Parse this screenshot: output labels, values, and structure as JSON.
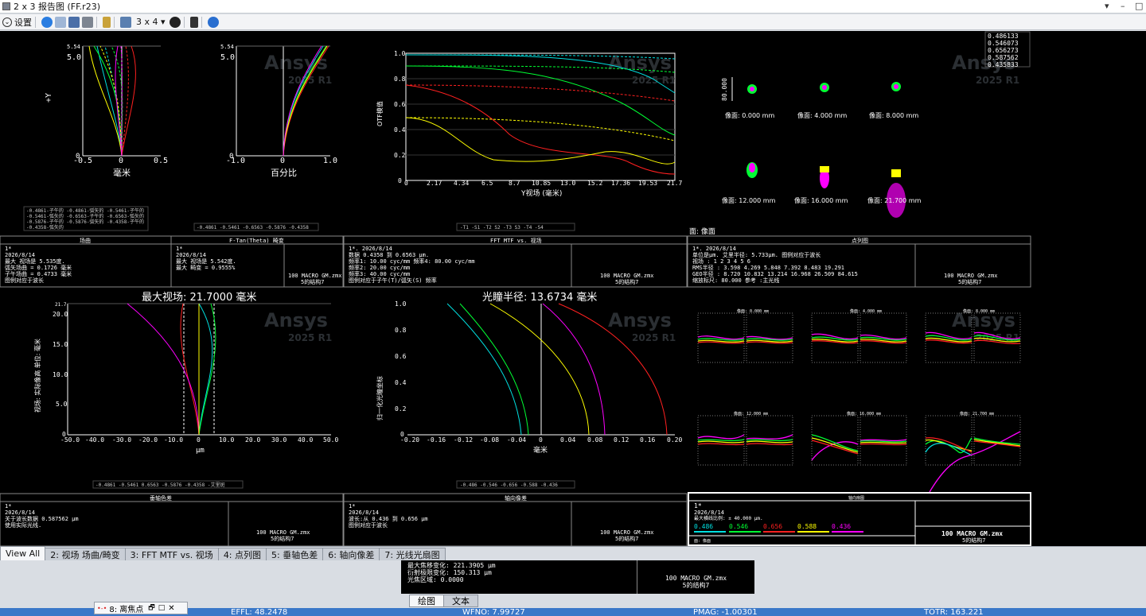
{
  "window": {
    "title": "2 x 3 报告图 (FF.r23)",
    "controls": [
      "▾",
      "–",
      "□"
    ]
  },
  "toolbar": {
    "settings_label": "设置",
    "layout_label": "3 x 4 ▾"
  },
  "watermark": {
    "line1": "Ansys",
    "line2": "2025 R1"
  },
  "panels": {
    "field_curv": {
      "axis_y_top": "5.54",
      "axis_y_mid": "5.0",
      "axis_y_zero": "0",
      "ylabel": "+Y",
      "xticks": [
        "-0.5",
        "0",
        "0.5"
      ],
      "xlabel": "毫米",
      "legend": [
        "-0.4861-子午的",
        "-0.4861-弧矢的",
        "-0.5461-子午的",
        "-0.5461-弧矢的",
        "-0.6563-子午的",
        "-0.6563-弧矢的",
        "-0.5876-子午的",
        "-0.5876-弧矢的",
        "-0.4358-子午的",
        "-0.4358-弧矢的"
      ]
    },
    "distortion": {
      "axis_y_top": "5.54",
      "axis_y_mid": "5.0",
      "axis_y_zero": "0",
      "xticks": [
        "-1.0",
        "0",
        "1.0"
      ],
      "xlabel": "百分比",
      "legend": "-0.4861 -0.5461 -0.6563 -0.5876 -0.4358"
    },
    "mtf": {
      "ylabel": "OTF模值",
      "yticks": [
        "1.0",
        "0.8",
        "0.6",
        "0.4",
        "0.2",
        "0"
      ],
      "xticks": [
        "0",
        "2.17",
        "4.34",
        "6.5",
        "8.7",
        "10.85",
        "13.0",
        "15.2",
        "17.36",
        "19.53",
        "21.7"
      ],
      "xlabel": "Y视场 (毫米)",
      "legend": "-T1 -S1 -T2 S2 -T3 S3 -T4 -S4"
    },
    "spot": {
      "scale_label": "80.000",
      "labels": [
        "像面: 0.000 mm",
        "像面: 4.000 mm",
        "像面: 8.000 mm",
        "像面: 12.000 mm",
        "像面: 16.000 mm",
        "像面: 21.700 mm"
      ],
      "wavelengths": [
        "0.486133",
        "0.546073",
        "0.656273",
        "0.587562",
        "0.435833"
      ],
      "surface_label": "面: 像面"
    },
    "lateral_color": {
      "title": "最大视场: 21.7000 毫米",
      "ylabel": "视场: 实际像高 单位: 毫米",
      "yticks": [
        "21.7",
        "20.0",
        "15.0",
        "10.0",
        "5.0",
        "0"
      ],
      "xticks": [
        "-50.0",
        "-40.0",
        "-30.0",
        "-20.0",
        "-10.0",
        "0",
        "10.0",
        "20.0",
        "30.0",
        "40.0",
        "50.0"
      ],
      "xlabel": "μm",
      "legend": "-0.4861 -0.5461 0.6563 -0.5876 -0.4358 -艾里斑"
    },
    "axial": {
      "title": "光瞳半径: 13.6734 毫米",
      "ylabel": "归一化光瞳坐标",
      "yticks": [
        "1.0",
        "0.8",
        "0.6",
        "0.4",
        "0.2",
        "0"
      ],
      "xticks": [
        "-0.20",
        "-0.16",
        "-0.12",
        "-0.08",
        "-0.04",
        "0",
        "0.04",
        "0.08",
        "0.12",
        "0.16",
        "0.20"
      ],
      "xlabel": "毫米",
      "legend": "-0.486 -0.546 -0.656 -0.588 -0.436"
    }
  },
  "info": {
    "field_curv": {
      "title": "场曲",
      "lines": [
        "1*",
        "2026/8/14",
        "最大 视场是 5.535度.",
        "弧矢场曲 = 0.1726 毫米",
        "子午场曲 = 0.4733 毫米",
        "图例对应于波长"
      ]
    },
    "distortion": {
      "title": "F-Tan(Theta) 畸变",
      "lines": [
        "1*",
        "2026/8/14",
        "最大 视场是 5.542度.",
        "最大 畸变 = 0.9555%"
      ],
      "file": "100 MACRO GM.zmx",
      "config": "5的结构7"
    },
    "mtf": {
      "title": "FFT MTF vs. 视场",
      "lines": [
        "1*. 2026/8/14",
        "数据 0.4358 到 0.6563 μm.",
        "频率1:  10.00 cyc/mm      频率4:  80.00 cyc/mm",
        "频率2:  20.00 cyc/mm",
        "频率3:  40.00 cyc/mm",
        "图例对应于子午(T)/弧矢(S) 频率"
      ],
      "file": "100 MACRO GM.zmx",
      "config": "5的结构7"
    },
    "spot": {
      "title": "点列图",
      "lines": [
        "1*. 2026/8/14",
        "单位是μm.           艾里半径: 5.733μm. 图例对应于波长",
        "视场    :     1        2         3         4         5         6",
        "RMS半径 :  3.598    4.269     5.848     7.392     8.483    19.291",
        "GEO半径 :  8.720   10.832    13.214    16.968    26.509    84.615",
        "缩放标尺:  80.000    参考 :主光线"
      ],
      "file": "100 MACRO GM.zmx",
      "config": "5的结构7"
    },
    "lateral_color": {
      "title": "垂轴色差",
      "lines": [
        "1*",
        "2026/8/14",
        "关于波长数据 0.587562 μm",
        "使用实际光线."
      ],
      "file": "100 MACRO GM.zmx",
      "config": "5的结构7"
    },
    "axial": {
      "title": "轴向像差",
      "lines": [
        "1*",
        "2026/8/14",
        "波长:从 0.436 到 0.656 μm",
        "图例对应于波长"
      ],
      "file": "100 MACRO GM.zmx",
      "config": "5的结构7"
    },
    "fan": {
      "title": "轴向扇图",
      "lines": [
        "1*",
        "2026/8/14",
        "最大横线比例: ± 40.000 μm."
      ],
      "wls": [
        "0.486",
        "0.546",
        "0.656",
        "0.588",
        "0.436"
      ],
      "footer": "面: 像面",
      "file": "100 MACRO GM.zmx",
      "config": "5的结构7"
    }
  },
  "fan_labels": [
    "像面: 0.000 mm",
    "像面: 4.000 mm",
    "像面: 8.000 mm",
    "像面: 12.000 mm",
    "像面: 16.000 mm",
    "像面: 21.700 mm"
  ],
  "tabs": [
    "View All",
    "2: 视场 场曲/畸变",
    "3: FFT MTF vs. 视场",
    "4: 点列图",
    "5: 垂轴色差",
    "6: 轴向像差",
    "7: 光线光扇图"
  ],
  "popup": {
    "lines": [
      "最大焦移变化: 221.3905 μm",
      "衍射极限变化: 150.313 μm",
      "光焦区域: 0.0000"
    ],
    "file": "100 MACRO GM.zmx",
    "config": "5的结构7",
    "tabs": [
      "绘图",
      "文本"
    ]
  },
  "dock": {
    "label": "8: 离焦点"
  },
  "status": {
    "effl": "EFFL: 48.2478",
    "wfno": "WFNO: 7.99727",
    "pmag": "PMAG: -1.00301",
    "totr": "TOTR: 163.221"
  },
  "colors": {
    "blue": "#3a78c8",
    "cyan": "#00e0e0",
    "green": "#00ff33",
    "red": "#ff2020",
    "yellow": "#ffff00",
    "magenta": "#ff00ff"
  }
}
